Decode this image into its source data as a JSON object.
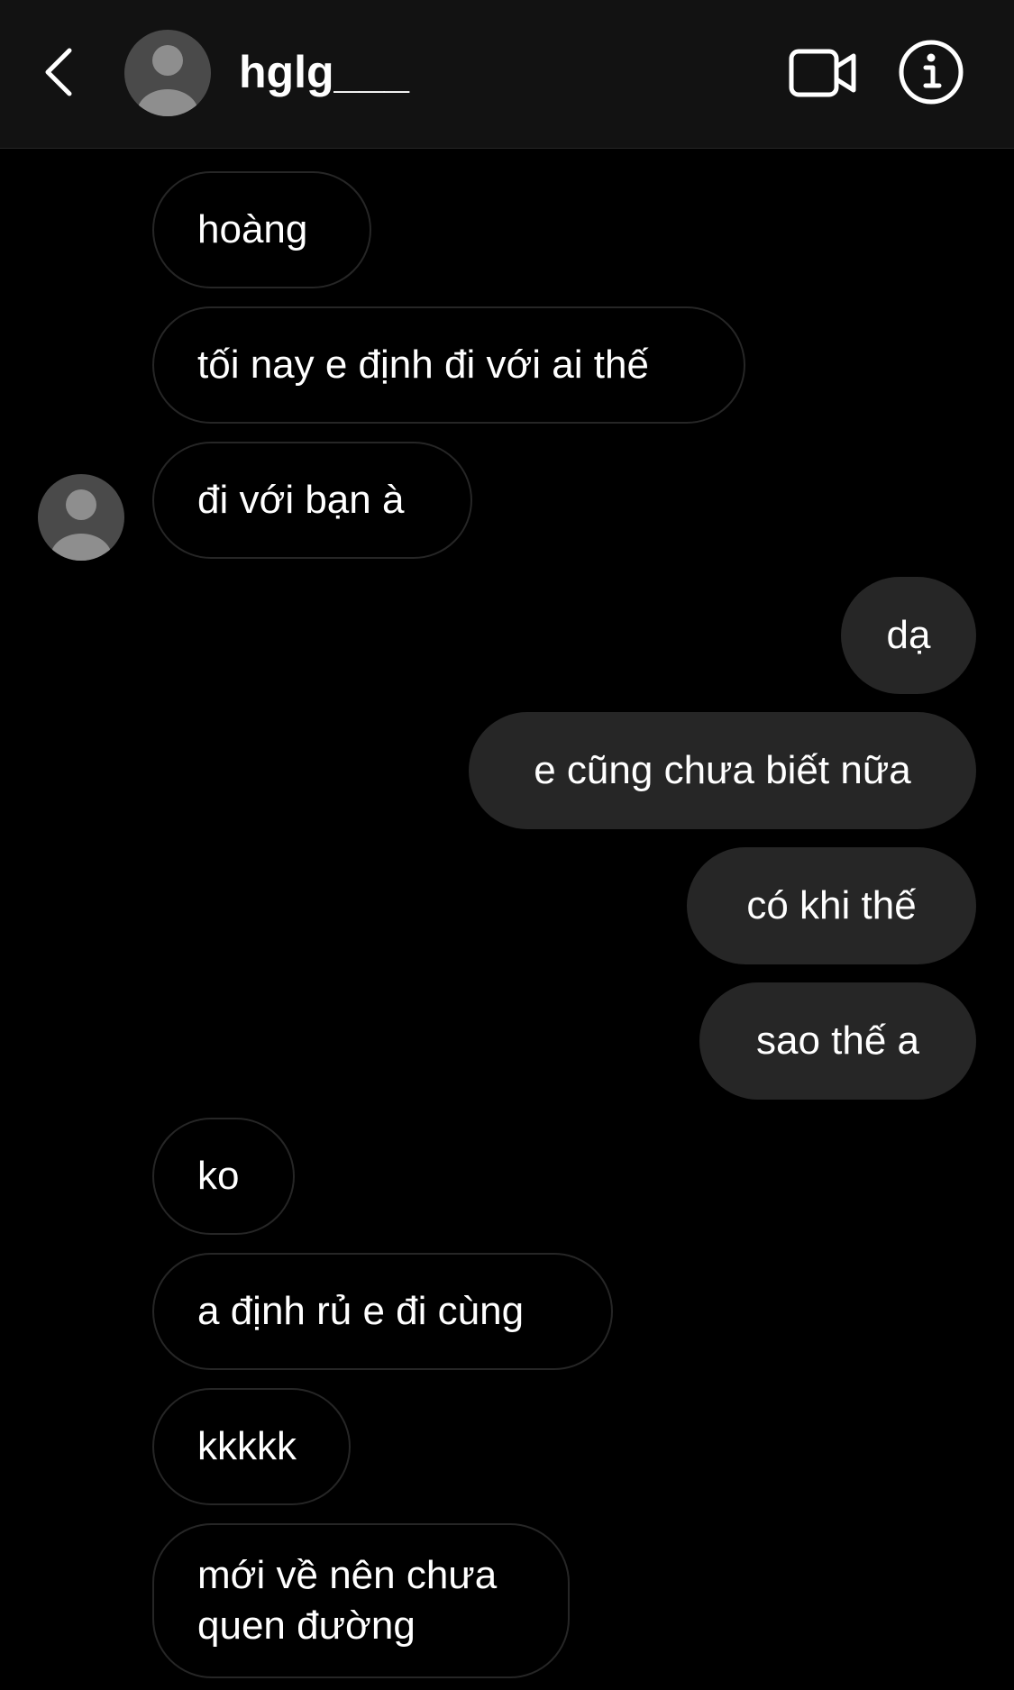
{
  "header": {
    "username": "hglg___",
    "icons": {
      "back": "chevron-left-icon",
      "avatar": "default-avatar-icon",
      "video": "video-call-icon",
      "info": "info-icon"
    }
  },
  "colors": {
    "background": "#000000",
    "header_background": "#121212",
    "incoming_border": "#262626",
    "outgoing_bubble": "#262626",
    "text": "#ffffff",
    "avatar_bg": "#4a4a4a",
    "avatar_fg": "#8e8e8e"
  },
  "messages": [
    {
      "direction": "incoming",
      "text": "hoàng"
    },
    {
      "direction": "incoming",
      "text": "tối nay e định đi với ai thế"
    },
    {
      "direction": "incoming",
      "text": "đi với bạn à"
    },
    {
      "direction": "outgoing",
      "text": "dạ"
    },
    {
      "direction": "outgoing",
      "text": "e cũng chưa biết nữa"
    },
    {
      "direction": "outgoing",
      "text": "có khi thế"
    },
    {
      "direction": "outgoing",
      "text": "sao thế a"
    },
    {
      "direction": "incoming",
      "text": "ko"
    },
    {
      "direction": "incoming",
      "text": "a định rủ e đi cùng"
    },
    {
      "direction": "incoming",
      "text": "kkkkk"
    },
    {
      "direction": "incoming",
      "text": "mới về nên chưa quen đường"
    }
  ]
}
